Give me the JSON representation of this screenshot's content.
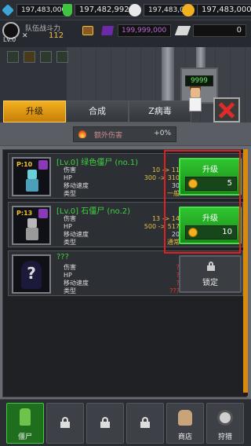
{
  "resources": {
    "diamond": "197,483,000",
    "potion": "197,482,992",
    "skull": "197,483,000",
    "gold": "197,483,000"
  },
  "player": {
    "level": "Lv.0",
    "team_label": "队伍战斗力",
    "team_value": "112",
    "gems": "199,999,000",
    "plates": "0"
  },
  "machine_counter": "9999",
  "tabs": [
    {
      "label": "升级",
      "active": true
    },
    {
      "label": "合成",
      "active": false
    },
    {
      "label": "Z病毒",
      "active": false
    }
  ],
  "out_damage": {
    "label": "额外伤害",
    "value": "+0%"
  },
  "zombies": [
    {
      "power": "P:10",
      "title": "[Lv.0] 绿色僵尸 (no.1)",
      "stats": [
        {
          "name": "伤害",
          "value": "10 -> 11"
        },
        {
          "name": "HP",
          "value": "300 -> 310"
        },
        {
          "name": "移动速度",
          "value": "30"
        },
        {
          "name": "类型",
          "value": "一般"
        }
      ],
      "button": {
        "label": "升级",
        "cost": "5"
      }
    },
    {
      "power": "P:13",
      "title": "[Lv.0] 石僵尸 (no.2)",
      "stats": [
        {
          "name": "伤害",
          "value": "13 -> 14"
        },
        {
          "name": "HP",
          "value": "500 -> 517"
        },
        {
          "name": "移动速度",
          "value": "20"
        },
        {
          "name": "类型",
          "value": "通常"
        }
      ],
      "button": {
        "label": "升级",
        "cost": "10"
      }
    },
    {
      "power": "",
      "title": "???",
      "stats": [
        {
          "name": "伤害",
          "value": "?"
        },
        {
          "name": "HP",
          "value": "?"
        },
        {
          "name": "移动速度",
          "value": "?"
        },
        {
          "name": "类型",
          "value": "???"
        }
      ],
      "button": {
        "label": "锁定"
      }
    }
  ],
  "bottom_nav": [
    {
      "label": "僵尸",
      "icon": "zombie-hand-icon",
      "active": true
    },
    {
      "label": "",
      "icon": "lock-icon"
    },
    {
      "label": "",
      "icon": "lock-icon"
    },
    {
      "label": "",
      "icon": "lock-icon"
    },
    {
      "label": "商店",
      "icon": "money-bag-icon"
    },
    {
      "label": "狩猎",
      "icon": "gas-mask-icon"
    }
  ],
  "colors": {
    "accent_green": "#2fc42f",
    "tab_active": "#f3b020",
    "highlight_red": "#e02020",
    "title_green": "#3fd03f"
  }
}
